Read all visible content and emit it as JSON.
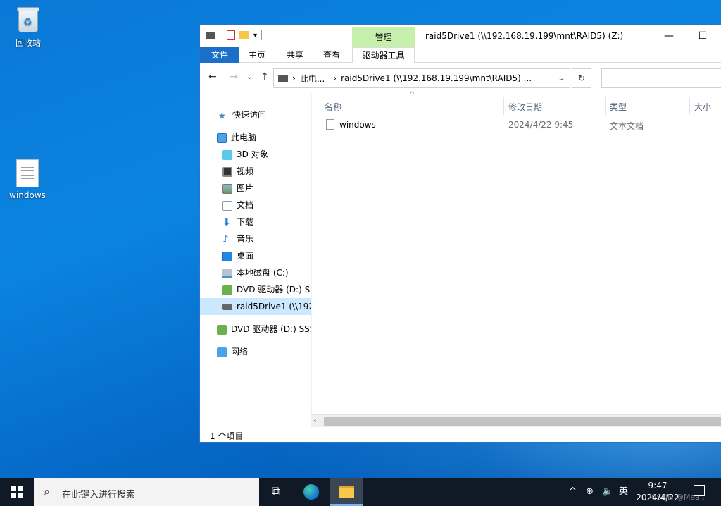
{
  "desktop": {
    "recycle_bin_label": "回收站",
    "file_icon_label": "windows"
  },
  "window": {
    "title": "raid5Drive1 (\\\\192.168.19.199\\mnt\\RAID5) (Z:)",
    "context_tab_header": "管理",
    "minimize_glyph": "—",
    "maximize_glyph": "☐",
    "tabs": [
      "文件",
      "主页",
      "共享",
      "查看",
      "驱动器工具"
    ]
  },
  "address": {
    "segment_1": "此电...",
    "segment_2": "raid5Drive1 (\\\\192.168.19.199\\mnt\\RAID5) ..."
  },
  "nav_pane": {
    "items": [
      {
        "label": "快速访问",
        "icon": "star-icon"
      },
      {
        "label": "此电脑",
        "icon": "computer-icon"
      },
      {
        "label": "3D 对象",
        "icon": "3d-objects-icon"
      },
      {
        "label": "视频",
        "icon": "video-icon"
      },
      {
        "label": "图片",
        "icon": "pictures-icon"
      },
      {
        "label": "文档",
        "icon": "documents-icon"
      },
      {
        "label": "下载",
        "icon": "download-icon"
      },
      {
        "label": "音乐",
        "icon": "music-icon"
      },
      {
        "label": "桌面",
        "icon": "desktop-icon"
      },
      {
        "label": "本地磁盘 (C:)",
        "icon": "disk-icon"
      },
      {
        "label": "DVD 驱动器 (D:) SS",
        "icon": "dvd-icon"
      },
      {
        "label": "raid5Drive1 (\\\\192",
        "icon": "network-drive-icon"
      },
      {
        "label": "DVD 驱动器 (D:) SSS",
        "icon": "dvd-icon"
      },
      {
        "label": "网络",
        "icon": "network-icon"
      }
    ]
  },
  "columns": {
    "name": "名称",
    "modified": "修改日期",
    "type": "类型",
    "size": "大小"
  },
  "files": [
    {
      "name": "windows",
      "modified": "2024/4/22 9:45",
      "type": "文本文档"
    }
  ],
  "status": {
    "count": "1 个项目"
  },
  "taskbar": {
    "search_placeholder": "在此键入进行搜索",
    "ime": "英",
    "time": "9:47",
    "date": "2024/4/22",
    "watermark": "CSDN @Mea..."
  }
}
